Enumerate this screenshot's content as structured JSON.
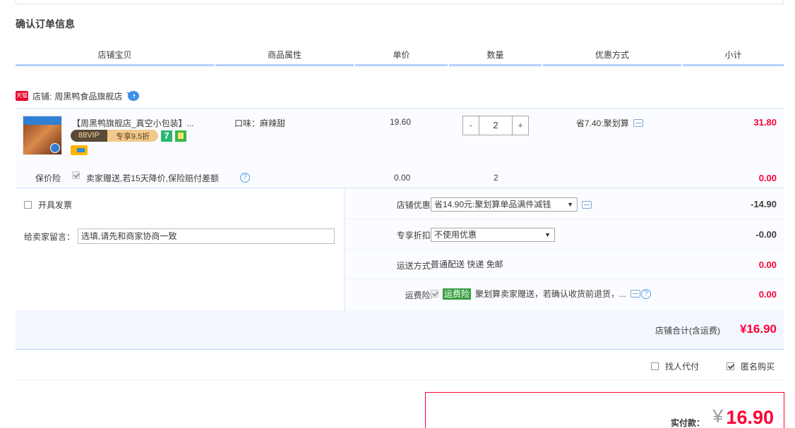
{
  "page": {
    "section_title": "确认订单信息"
  },
  "columns": [
    "店铺宝贝",
    "商品属性",
    "单价",
    "数量",
    "优惠方式",
    "小计"
  ],
  "shop": {
    "badge": "天猫",
    "label": "店铺:",
    "name": "周黑鸭食品旗舰店"
  },
  "item": {
    "title": "【周黑鸭旗舰店_真空小包装】...",
    "vip_left": "88VIP",
    "vip_right": "专享9.5折",
    "sevenday_label": "7",
    "attribute": "口味：麻辣甜",
    "unit_price": "19.60",
    "qty_minus": "-",
    "qty_value": "2",
    "qty_plus": "+",
    "discount": "省7.40:聚划算",
    "subtotal": "31.80"
  },
  "insurance": {
    "label": "保价险",
    "checked": true,
    "text": "卖家赠送,若15天降价,保险赔付差额",
    "help": "?",
    "price": "0.00",
    "qty": "2",
    "subtotal": "0.00"
  },
  "options": {
    "invoice_label": "开具发票",
    "note_label": "给卖家留言：",
    "note_placeholder": "选填,请先和商家协商一致",
    "shop_coupon_label": "店铺优惠:",
    "shop_coupon_value": "省14.90元:聚划算单品满件减钱",
    "shop_coupon_amount": "-14.90",
    "vip_discount_label": "专享折扣:",
    "vip_discount_value": "不使用优惠",
    "vip_discount_amount": "-0.00",
    "shipping_label": "运送方式:",
    "shipping_value": "普通配送 快递 免邮",
    "shipping_amount": "0.00",
    "shipping_ins_label": "运费险:",
    "shipping_ins_tag": "运费险",
    "shipping_ins_text": "聚划算卖家赠送，若确认收货前退货，...",
    "shipping_ins_help": "?",
    "shipping_ins_amount": "0.00",
    "select_arrow": "▼"
  },
  "shop_total": {
    "label": "店铺合计(含运费)",
    "amount": "¥16.90"
  },
  "extras": {
    "proxy_pay_label": "找人代付",
    "proxy_pay_checked": false,
    "anonymous_label": "匿名购买",
    "anonymous_checked": true
  },
  "payment": {
    "label": "实付款：",
    "currency": "¥",
    "amount": "16.90"
  },
  "colors": {
    "accent_red": "#ff0036",
    "header_line": "#b2d1ff",
    "panel_bg": "#f2f7ff"
  }
}
